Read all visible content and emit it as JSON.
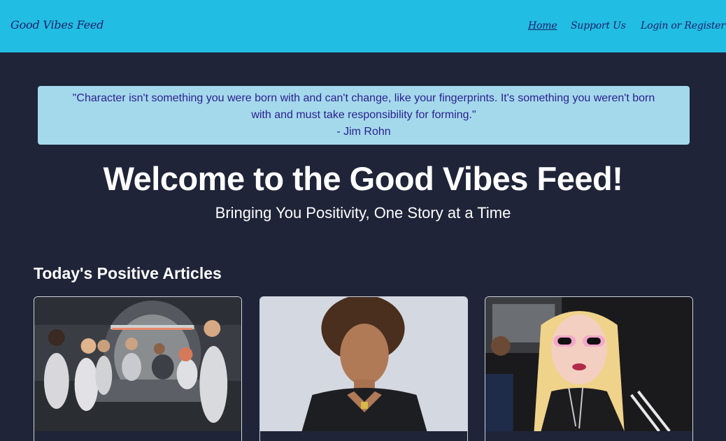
{
  "nav": {
    "brand": "Good Vibes Feed",
    "links": [
      {
        "label": "Home",
        "active": true
      },
      {
        "label": "Support Us",
        "active": false
      },
      {
        "label": "Login or Register",
        "active": false
      }
    ]
  },
  "quote": {
    "text": "\"Character isn't something you were born with and can't change, like your fingerprints. It's something you weren't born with and must take responsibility for forming.\"",
    "author": "- Jim Rohn"
  },
  "hero": {
    "title": "Welcome to the Good Vibes Feed!",
    "subtitle": "Bringing You Positivity, One Story at a Time"
  },
  "articles": {
    "heading": "Today's Positive Articles",
    "cards": [
      {
        "image": "group-meeting-photo"
      },
      {
        "image": "woman-portrait-photo"
      },
      {
        "image": "singer-sunglasses-photo"
      }
    ]
  },
  "colors": {
    "navbar": "#22bde2",
    "background": "#1f2438",
    "quote_bg": "#a4d9ec",
    "quote_text": "#2a1f8f",
    "nav_text": "#1b1f6b"
  }
}
